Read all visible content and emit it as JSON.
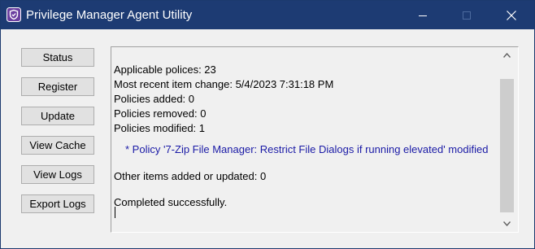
{
  "window": {
    "title": "Privilege Manager Agent Utility",
    "title_bar_color": "#1d3b73",
    "app_icon": "shield-icon",
    "controls": {
      "minimize_icon": "minimize-icon",
      "maximize_icon": "maximize-icon",
      "close_icon": "close-icon"
    }
  },
  "sidebar": {
    "buttons": [
      {
        "label": "Status"
      },
      {
        "label": "Register"
      },
      {
        "label": "Update"
      },
      {
        "label": "View Cache"
      },
      {
        "label": "View Logs"
      },
      {
        "label": "Export Logs"
      }
    ]
  },
  "output": {
    "lines": [
      "Applicable polices: 23",
      "Most recent item change: 5/4/2023 7:31:18 PM",
      "Policies added: 0",
      "Policies removed: 0",
      "Policies modified: 1",
      "* Policy '7-Zip File Manager: Restrict File Dialogs if running elevated' modified",
      "Other items added or updated: 0",
      "Completed successfully."
    ],
    "highlight_color": "#1a1aa6"
  },
  "scrollbar": {
    "up_icon": "chevron-up-icon",
    "down_icon": "chevron-down-icon"
  }
}
